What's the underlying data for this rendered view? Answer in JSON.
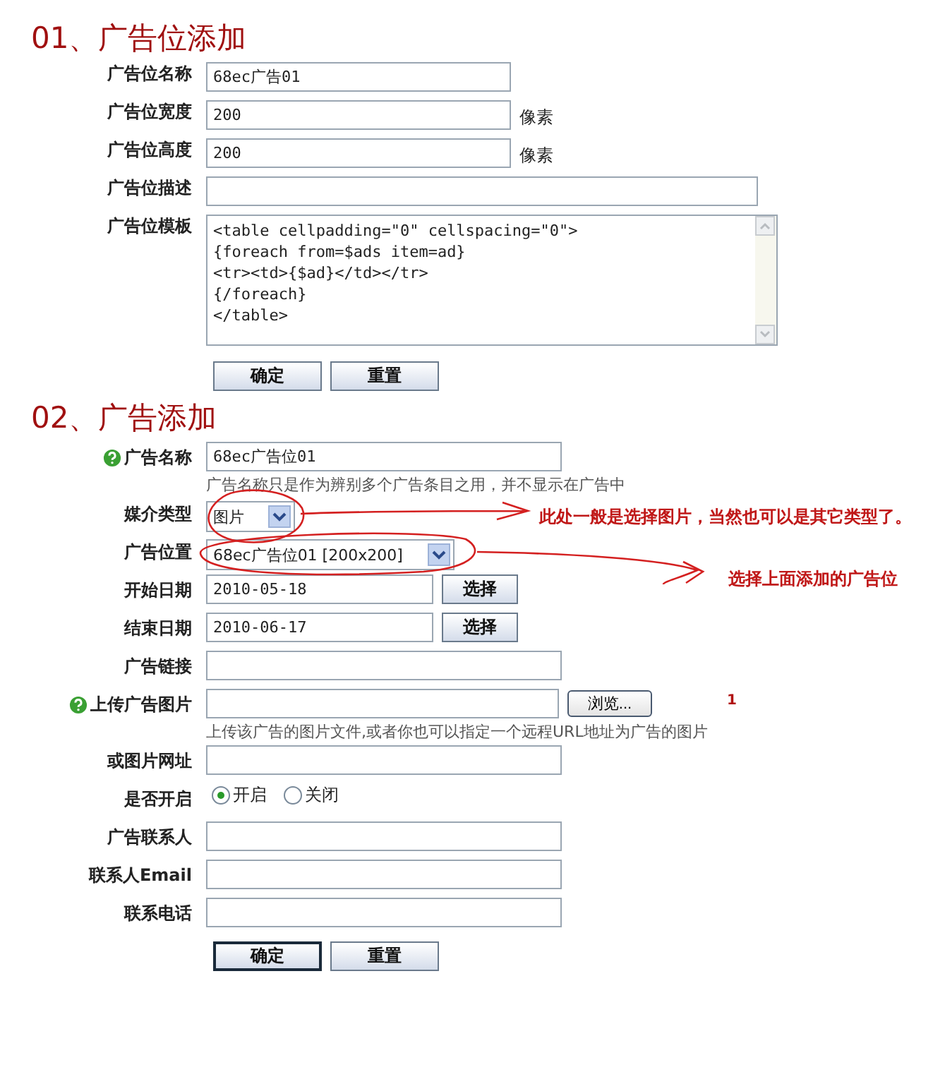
{
  "sections": [
    {
      "title": "01、广告位添加",
      "fields": [
        {
          "kind": "text",
          "label": "广告位名称",
          "value": "68ec广告01"
        },
        {
          "kind": "text",
          "label": "广告位宽度",
          "value": "200",
          "unit": "像素"
        },
        {
          "kind": "text",
          "label": "广告位高度",
          "value": "200",
          "unit": "像素"
        },
        {
          "kind": "text",
          "label": "广告位描述"
        },
        {
          "kind": "textarea",
          "label": "广告位模板",
          "lines": [
            "<table cellpadding=\"0\" cellspacing=\"0\">",
            "{foreach from=$ads item=ad}",
            "<tr><td>{$ad}</td></tr>",
            "{/foreach}",
            "</table>"
          ]
        }
      ],
      "buttons": [
        {
          "label": "确定",
          "default": false
        },
        {
          "label": "重置",
          "default": false
        }
      ]
    },
    {
      "title": "02、广告添加",
      "fields": [
        {
          "kind": "text",
          "label": "广告名称",
          "help": true,
          "value": "68ec广告位01",
          "hint": "广告名称只是作为辨别多个广告条目之用，并不显示在广告中"
        },
        {
          "kind": "select",
          "label": "媒介类型",
          "value": "图片"
        },
        {
          "kind": "select",
          "label": "广告位置",
          "value": "68ec广告位01 [200x200]"
        },
        {
          "kind": "date",
          "label": "开始日期",
          "value": "2010-05-18",
          "button": "选择"
        },
        {
          "kind": "date",
          "label": "结束日期",
          "value": "2010-06-17",
          "button": "选择"
        },
        {
          "kind": "text",
          "label": "广告链接"
        },
        {
          "kind": "file",
          "label": "上传广告图片",
          "help": true,
          "button": "浏览...",
          "hint": "上传该广告的图片文件,或者你也可以指定一个远程URL地址为广告的图片"
        },
        {
          "kind": "text",
          "label": "或图片网址"
        },
        {
          "kind": "radio",
          "label": "是否开启",
          "options": [
            {
              "label": "开启",
              "selected": true
            },
            {
              "label": "关闭",
              "selected": false
            }
          ]
        },
        {
          "kind": "text",
          "label": "广告联系人"
        },
        {
          "kind": "text",
          "label": "联系人Email"
        },
        {
          "kind": "text",
          "label": "联系电话"
        }
      ],
      "buttons": [
        {
          "label": "确定",
          "default": true
        },
        {
          "label": "重置",
          "default": false
        }
      ]
    }
  ],
  "annotations": [
    {
      "text": "此处一般是选择图片，当然也可以是其它类型了。"
    },
    {
      "text": "选择上面添加的广告位"
    }
  ],
  "stray_mark": "1"
}
